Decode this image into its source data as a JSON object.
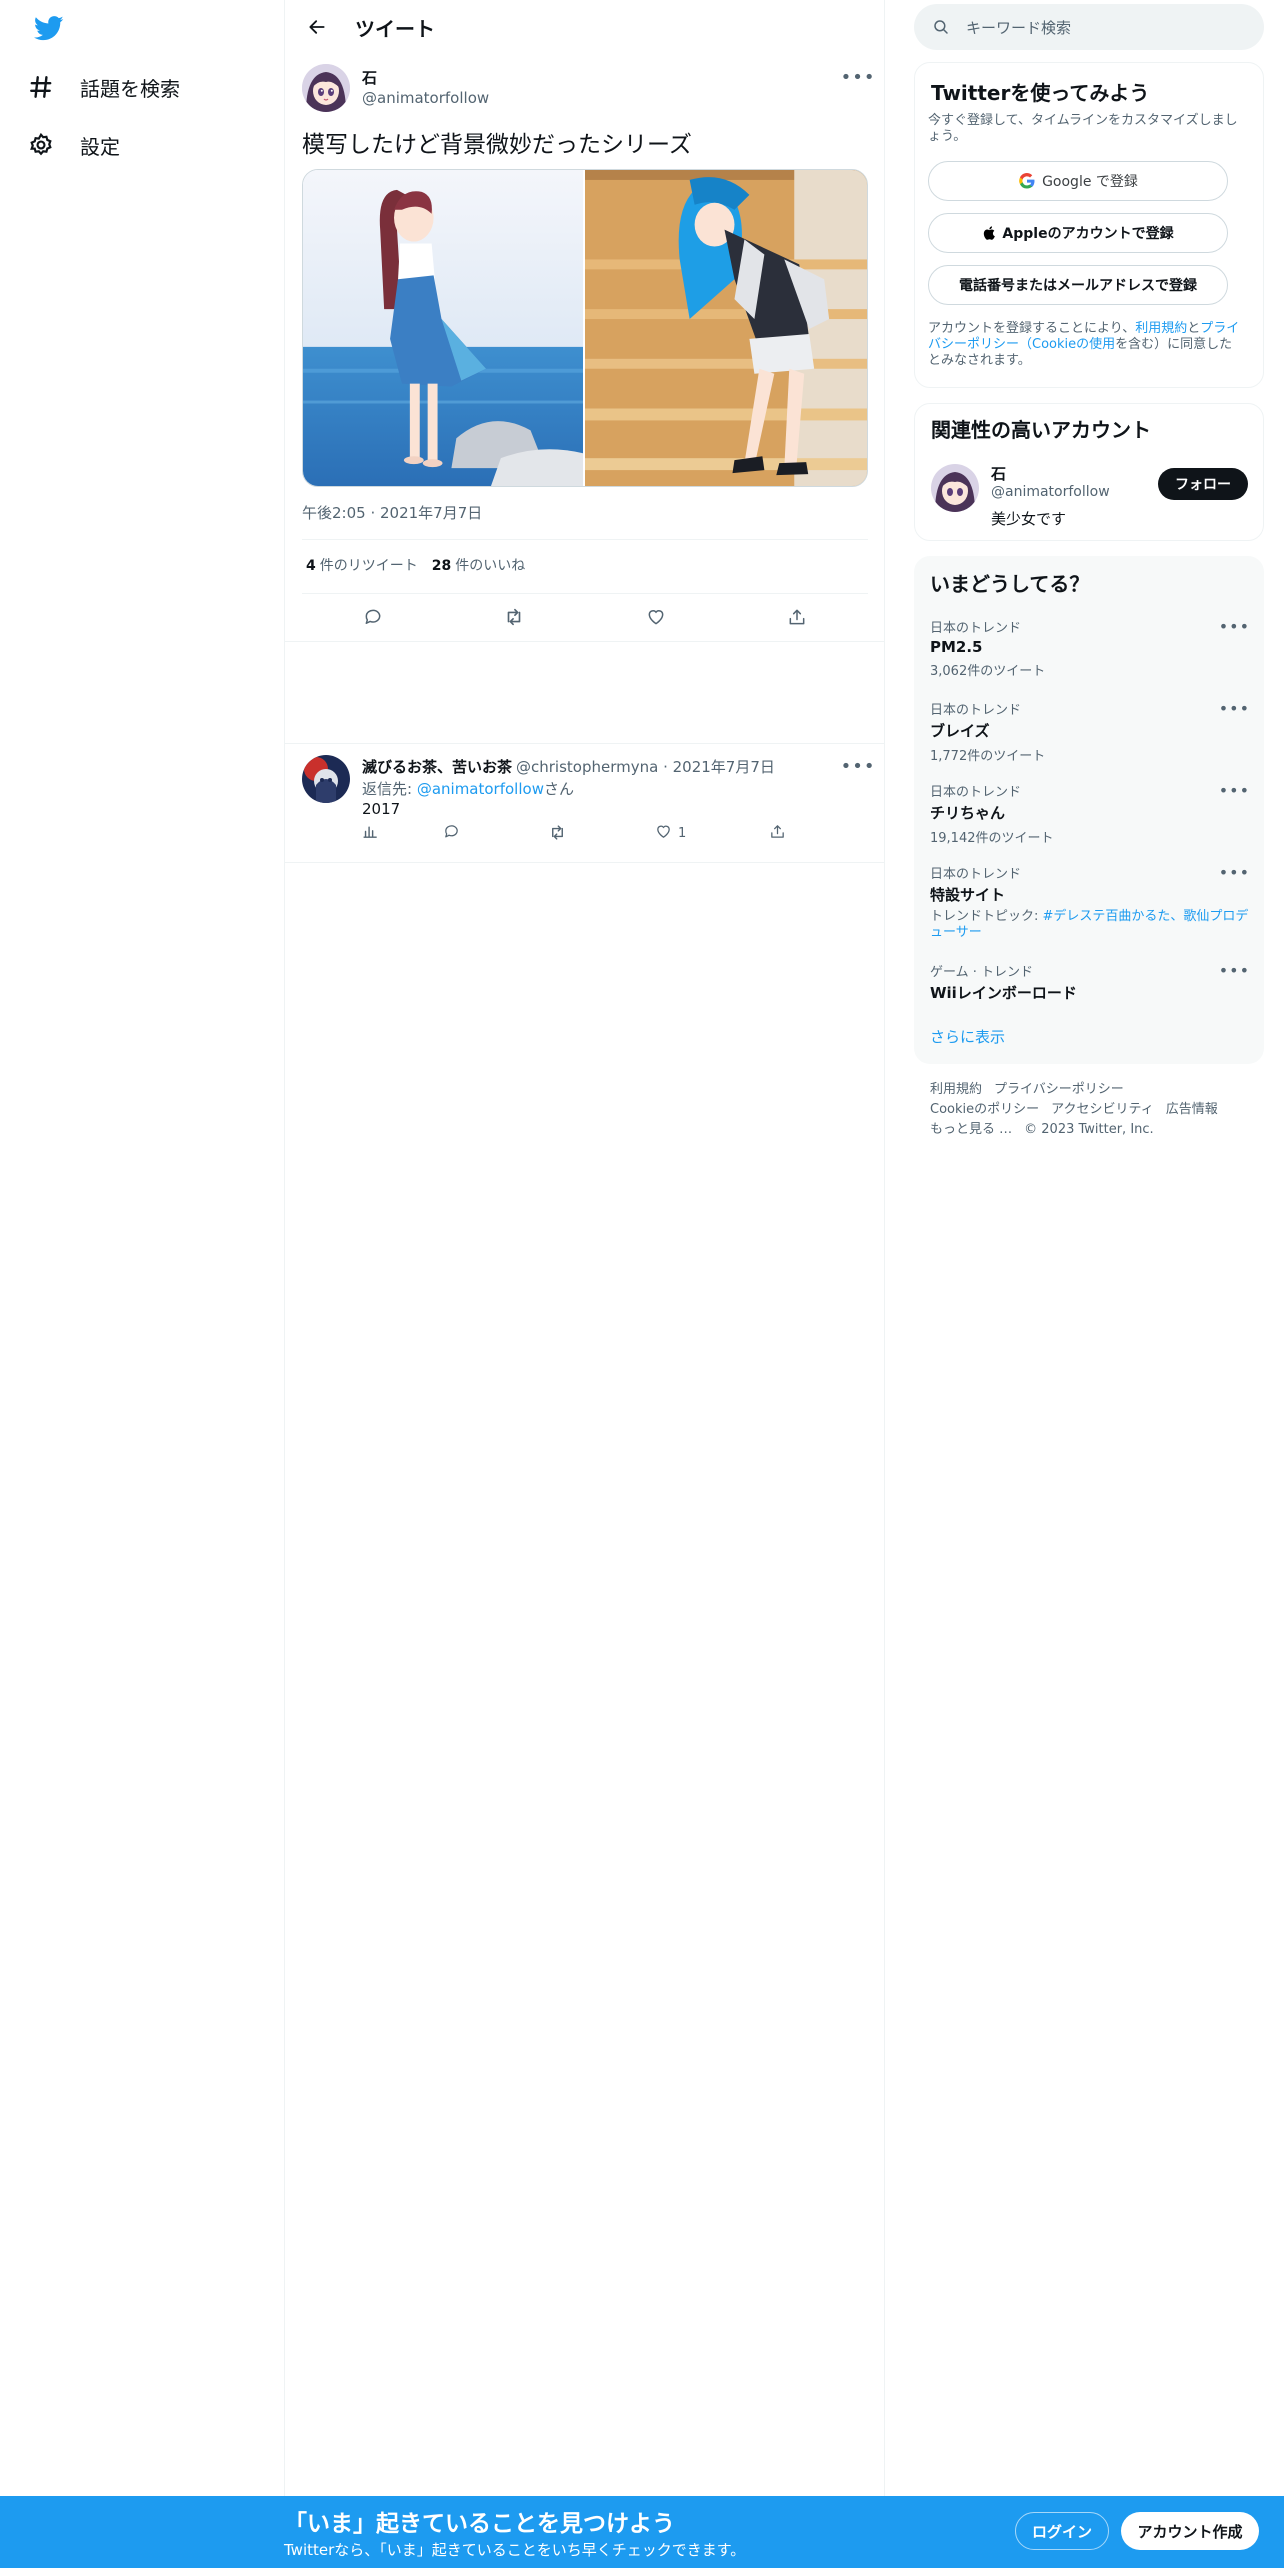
{
  "nav": {
    "explore": "話題を検索",
    "settings": "設定"
  },
  "header": {
    "title": "ツイート"
  },
  "tweet": {
    "author_name": "石",
    "author_handle": "@animatorfollow",
    "text": "模写したけど背景微妙だったシリーズ",
    "time": "午後2:05 · 2021年7月7日",
    "retweet_count": "4",
    "retweet_label": "件のリツイート",
    "like_count": "28",
    "like_label": "件のいいね"
  },
  "reply": {
    "author_name": "滅びるお茶、苦いお茶",
    "author_handle": "@christophermyna · 2021年7月7日",
    "replying_prefix": "返信先: ",
    "replying_to": "@animatorfollow",
    "replying_suffix": "さん",
    "text": "2017",
    "like_count": "1"
  },
  "search": {
    "placeholder": "キーワード検索"
  },
  "signup": {
    "title": "Twitterを使ってみよう",
    "subtitle": "今すぐ登録して、タイムラインをカスタマイズしましょう。",
    "google": "Google で登録",
    "apple": "Appleのアカウントで登録",
    "phone": "電話番号またはメールアドレスで登録",
    "legal_prefix": "アカウントを登録することにより、",
    "legal_terms": "利用規約",
    "legal_and": "と",
    "legal_privacy": "プライバシーポリシー（Cookieの使用",
    "legal_suffix": "を含む）に同意したとみなされます。"
  },
  "related": {
    "title": "関連性の高いアカウント",
    "name": "石",
    "handle": "@animatorfollow",
    "bio": "美少女です",
    "follow": "フォロー"
  },
  "trends": {
    "title": "いまどうしてる？",
    "items": [
      {
        "category": "日本のトレンド",
        "name": "PM2.5",
        "count": "3,062件のツイート"
      },
      {
        "category": "日本のトレンド",
        "name": "ブレイズ",
        "count": "1,772件のツイート"
      },
      {
        "category": "日本のトレンド",
        "name": "チリちゃん",
        "count": "19,142件のツイート"
      },
      {
        "category": "日本のトレンド",
        "name": "特設サイト",
        "topic_prefix": "トレンドトピック: ",
        "topic": "#デレステ百曲かるた、歌仙プロデューサー"
      },
      {
        "category": "ゲーム · トレンド",
        "name": "Wiiレインボーロード"
      }
    ],
    "show_more": "さらに表示"
  },
  "footer": {
    "links": [
      "利用規約",
      "プライバシーポリシー",
      "Cookieのポリシー",
      "アクセシビリティ",
      "広告情報",
      "もっと見る …"
    ],
    "copyright": "© 2023 Twitter, Inc."
  },
  "banner": {
    "headline": "「いま」起きていることを見つけよう",
    "sub": "Twitterなら、「いま」起きていることをいち早くチェックできます。",
    "login": "ログイン",
    "signup": "アカウント作成"
  },
  "colors": {
    "accent": "#1d9bf0",
    "text": "#0f1419",
    "secondary": "#536471",
    "border": "#eff3f4"
  }
}
